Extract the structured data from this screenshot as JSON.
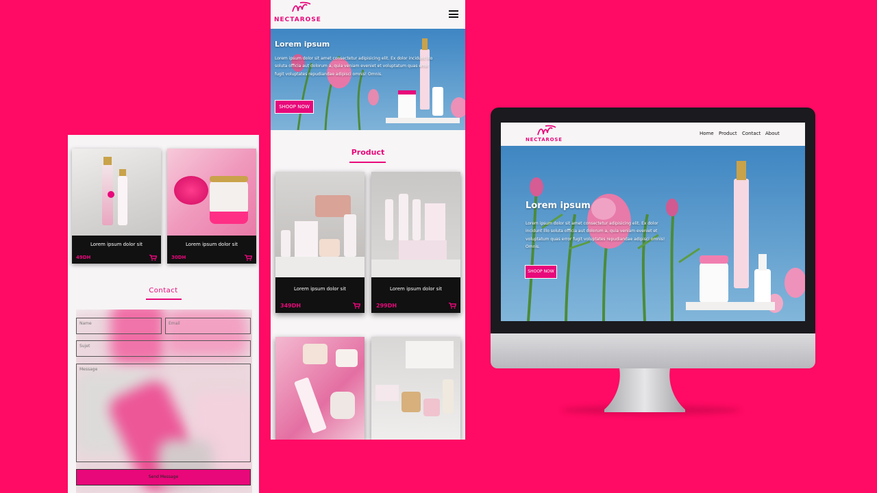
{
  "brand": {
    "logo_mark": "nr",
    "name": "NECTAROSE",
    "accent": "#e8087a",
    "background": "#ff0a64"
  },
  "nav": {
    "items": [
      "Home",
      "Product",
      "Contact",
      "About"
    ]
  },
  "hero": {
    "title": "Lorem ipsum",
    "text": "Lorem ipsum dolor sit amet consectetur adipisicing elit. Ex dolor incidunt illo soluta officia aut dolorum a, quia veniam eveniet et voluptatum quas error fugit voluptates repudiandae adipisci omnis! Omnis.",
    "button": "SHOOP NOW"
  },
  "product_section": {
    "title": "Product"
  },
  "products": [
    {
      "title": "Lorem ipsum dolor sit",
      "price": "49DH"
    },
    {
      "title": "Lorem ipsum dolor sit",
      "price": "30DH"
    },
    {
      "title": "Lorem ipsum dolor sit",
      "price": "349DH"
    },
    {
      "title": "Lorem ipsum dolor sit",
      "price": "299DH"
    }
  ],
  "contact": {
    "title": "Contact",
    "name_placeholder": "Name",
    "email_placeholder": "Email",
    "subject_placeholder": "Sujet",
    "message_placeholder": "Message",
    "send_label": "Send Message"
  },
  "icons": {
    "menu": "hamburger-icon",
    "cart": "cart-icon"
  }
}
